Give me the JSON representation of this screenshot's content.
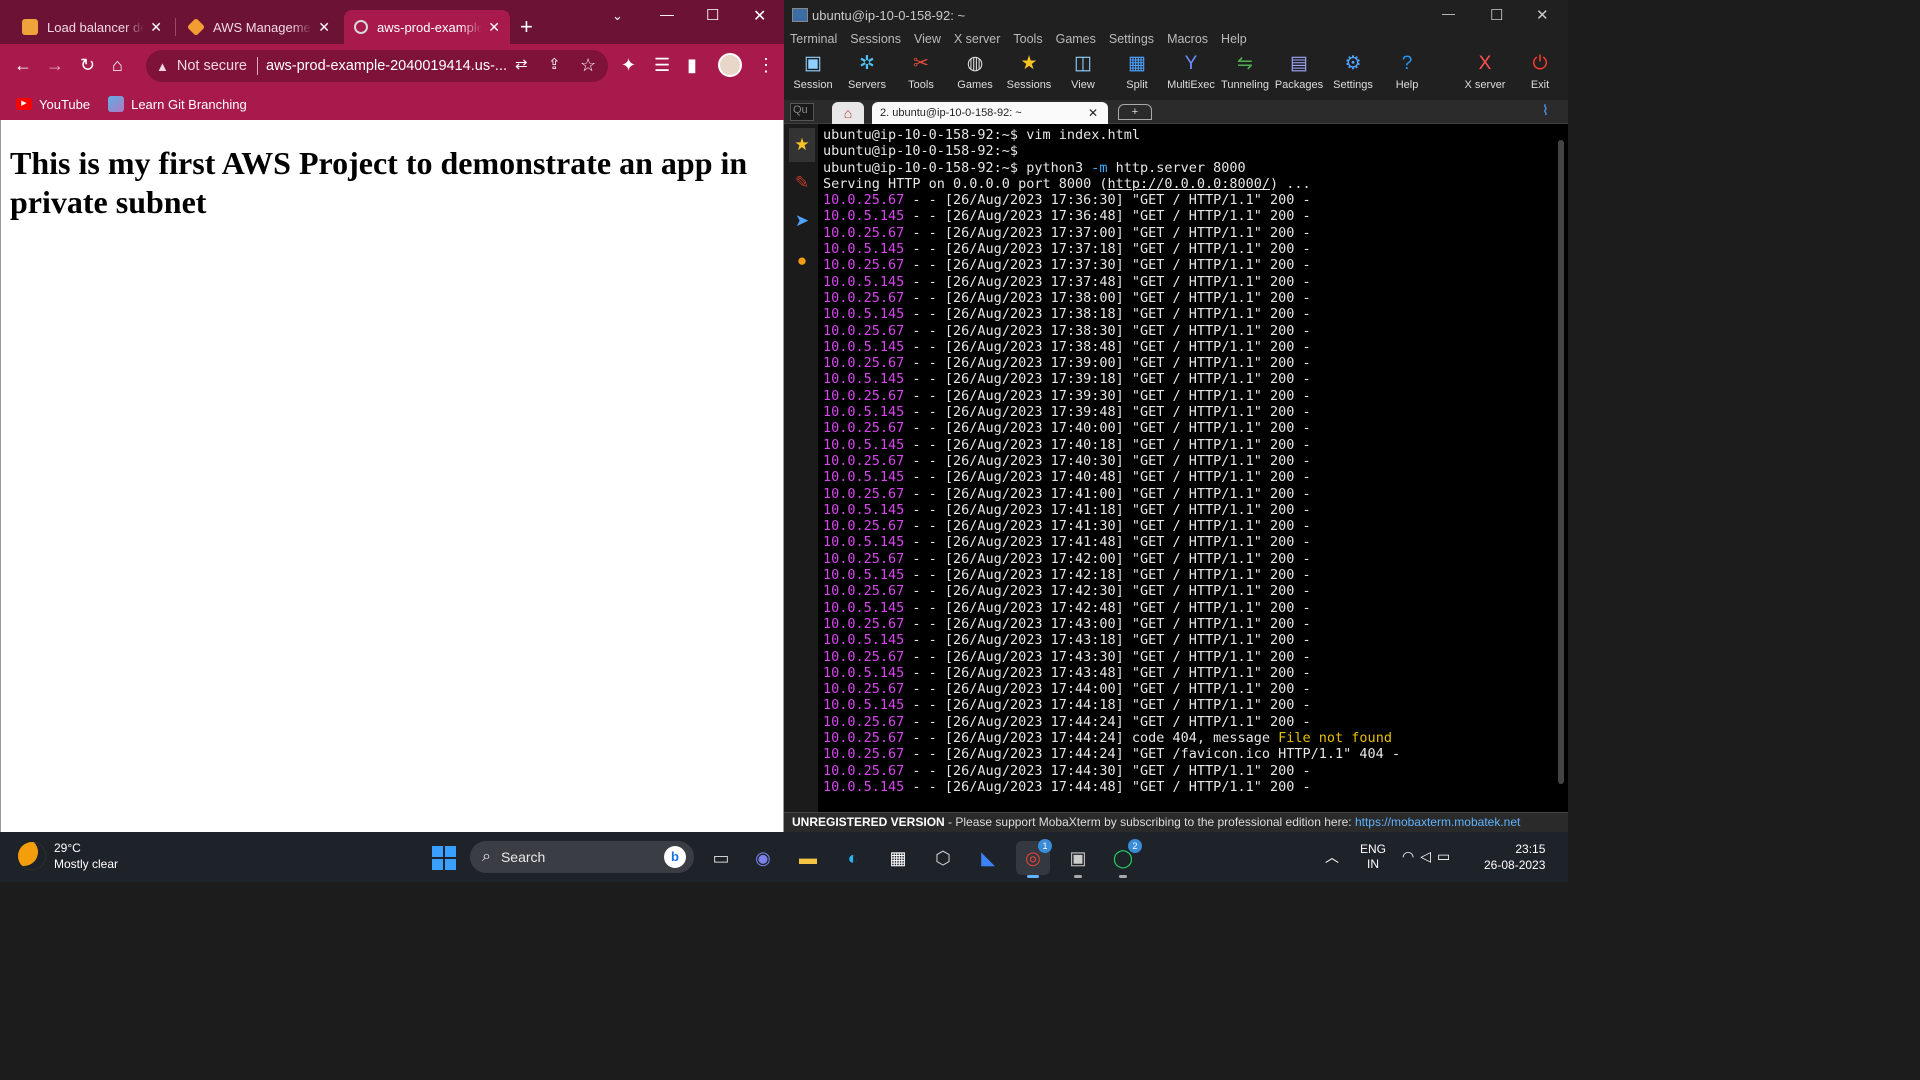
{
  "chrome": {
    "tabs": [
      {
        "title": "Load balancer deta",
        "favicon_color": "#f0a33a"
      },
      {
        "title": "AWS Management",
        "favicon_color": "#f39c32"
      },
      {
        "title": "aws-prod-example",
        "favicon_color": "#d7d7d7"
      }
    ],
    "address": {
      "security_label": "Not secure",
      "url": "aws-prod-example-2040019414.us-..."
    },
    "bookmarks": [
      {
        "label": "YouTube",
        "icon": "youtube-icon"
      },
      {
        "label": "Learn Git Branching",
        "icon": "git-icon"
      }
    ],
    "page_heading": "This is my first AWS Project to demonstrate an app in private subnet"
  },
  "moba": {
    "window_title": "ubuntu@ip-10-0-158-92: ~",
    "menu": [
      "Terminal",
      "Sessions",
      "View",
      "X server",
      "Tools",
      "Games",
      "Settings",
      "Macros",
      "Help"
    ],
    "toolbar": [
      {
        "label": "Session",
        "icon": "monitor-icon",
        "color": "#8fd0ff"
      },
      {
        "label": "Servers",
        "icon": "servers-icon",
        "color": "#4fc3f7"
      },
      {
        "label": "Tools",
        "icon": "tools-icon",
        "color": "#e74c3c"
      },
      {
        "label": "Games",
        "icon": "gamepad-icon",
        "color": "#dddddd"
      },
      {
        "label": "Sessions",
        "icon": "star-icon",
        "color": "#f7c325"
      },
      {
        "label": "View",
        "icon": "view-icon",
        "color": "#8fd0ff"
      },
      {
        "label": "Split",
        "icon": "split-icon",
        "color": "#4fa3ff"
      },
      {
        "label": "MultiExec",
        "icon": "multiexec-icon",
        "color": "#6c8cff"
      },
      {
        "label": "Tunneling",
        "icon": "tunneling-icon",
        "color": "#4caf50"
      },
      {
        "label": "Packages",
        "icon": "packages-icon",
        "color": "#9fa8ff"
      },
      {
        "label": "Settings",
        "icon": "settings-icon",
        "color": "#4fa3ff"
      },
      {
        "label": "Help",
        "icon": "help-icon",
        "color": "#2196f3"
      },
      {
        "label": "X server",
        "icon": "xserver-icon",
        "color": "#ff5252"
      },
      {
        "label": "Exit",
        "icon": "power-icon",
        "color": "#ff3b30"
      }
    ],
    "quick_connect": "Qu",
    "session_tab": "2. ubuntu@ip-10-0-158-92: ~",
    "terminal": {
      "prompt": "ubuntu@ip-10-0-158-92:~$",
      "commands": [
        {
          "cmd": "vim index.html"
        },
        {
          "cmd": ""
        },
        {
          "cmd_pre": "python3 ",
          "opt": "-m",
          "cmd_post": " http.server 8000"
        }
      ],
      "serving_pre": "Serving HTTP on 0.0.0.0 port 8000 (",
      "serving_link": "http://0.0.0.0:8000/",
      "serving_post": ") ...",
      "log": [
        {
          "ip": "10.0.25.67",
          "rest": " - - [26/Aug/2023 17:36:30] \"GET / HTTP/1.1\" 200 -"
        },
        {
          "ip": "10.0.5.145",
          "rest": " - - [26/Aug/2023 17:36:48] \"GET / HTTP/1.1\" 200 -"
        },
        {
          "ip": "10.0.25.67",
          "rest": " - - [26/Aug/2023 17:37:00] \"GET / HTTP/1.1\" 200 -"
        },
        {
          "ip": "10.0.5.145",
          "rest": " - - [26/Aug/2023 17:37:18] \"GET / HTTP/1.1\" 200 -"
        },
        {
          "ip": "10.0.25.67",
          "rest": " - - [26/Aug/2023 17:37:30] \"GET / HTTP/1.1\" 200 -"
        },
        {
          "ip": "10.0.5.145",
          "rest": " - - [26/Aug/2023 17:37:48] \"GET / HTTP/1.1\" 200 -"
        },
        {
          "ip": "10.0.25.67",
          "rest": " - - [26/Aug/2023 17:38:00] \"GET / HTTP/1.1\" 200 -"
        },
        {
          "ip": "10.0.5.145",
          "rest": " - - [26/Aug/2023 17:38:18] \"GET / HTTP/1.1\" 200 -"
        },
        {
          "ip": "10.0.25.67",
          "rest": " - - [26/Aug/2023 17:38:30] \"GET / HTTP/1.1\" 200 -"
        },
        {
          "ip": "10.0.5.145",
          "rest": " - - [26/Aug/2023 17:38:48] \"GET / HTTP/1.1\" 200 -"
        },
        {
          "ip": "10.0.25.67",
          "rest": " - - [26/Aug/2023 17:39:00] \"GET / HTTP/1.1\" 200 -"
        },
        {
          "ip": "10.0.5.145",
          "rest": " - - [26/Aug/2023 17:39:18] \"GET / HTTP/1.1\" 200 -"
        },
        {
          "ip": "10.0.25.67",
          "rest": " - - [26/Aug/2023 17:39:30] \"GET / HTTP/1.1\" 200 -"
        },
        {
          "ip": "10.0.5.145",
          "rest": " - - [26/Aug/2023 17:39:48] \"GET / HTTP/1.1\" 200 -"
        },
        {
          "ip": "10.0.25.67",
          "rest": " - - [26/Aug/2023 17:40:00] \"GET / HTTP/1.1\" 200 -"
        },
        {
          "ip": "10.0.5.145",
          "rest": " - - [26/Aug/2023 17:40:18] \"GET / HTTP/1.1\" 200 -"
        },
        {
          "ip": "10.0.25.67",
          "rest": " - - [26/Aug/2023 17:40:30] \"GET / HTTP/1.1\" 200 -"
        },
        {
          "ip": "10.0.5.145",
          "rest": " - - [26/Aug/2023 17:40:48] \"GET / HTTP/1.1\" 200 -"
        },
        {
          "ip": "10.0.25.67",
          "rest": " - - [26/Aug/2023 17:41:00] \"GET / HTTP/1.1\" 200 -"
        },
        {
          "ip": "10.0.5.145",
          "rest": " - - [26/Aug/2023 17:41:18] \"GET / HTTP/1.1\" 200 -"
        },
        {
          "ip": "10.0.25.67",
          "rest": " - - [26/Aug/2023 17:41:30] \"GET / HTTP/1.1\" 200 -"
        },
        {
          "ip": "10.0.5.145",
          "rest": " - - [26/Aug/2023 17:41:48] \"GET / HTTP/1.1\" 200 -"
        },
        {
          "ip": "10.0.25.67",
          "rest": " - - [26/Aug/2023 17:42:00] \"GET / HTTP/1.1\" 200 -"
        },
        {
          "ip": "10.0.5.145",
          "rest": " - - [26/Aug/2023 17:42:18] \"GET / HTTP/1.1\" 200 -"
        },
        {
          "ip": "10.0.25.67",
          "rest": " - - [26/Aug/2023 17:42:30] \"GET / HTTP/1.1\" 200 -"
        },
        {
          "ip": "10.0.5.145",
          "rest": " - - [26/Aug/2023 17:42:48] \"GET / HTTP/1.1\" 200 -"
        },
        {
          "ip": "10.0.25.67",
          "rest": " - - [26/Aug/2023 17:43:00] \"GET / HTTP/1.1\" 200 -"
        },
        {
          "ip": "10.0.5.145",
          "rest": " - - [26/Aug/2023 17:43:18] \"GET / HTTP/1.1\" 200 -"
        },
        {
          "ip": "10.0.25.67",
          "rest": " - - [26/Aug/2023 17:43:30] \"GET / HTTP/1.1\" 200 -"
        },
        {
          "ip": "10.0.5.145",
          "rest": " - - [26/Aug/2023 17:43:48] \"GET / HTTP/1.1\" 200 -"
        },
        {
          "ip": "10.0.25.67",
          "rest": " - - [26/Aug/2023 17:44:00] \"GET / HTTP/1.1\" 200 -"
        },
        {
          "ip": "10.0.5.145",
          "rest": " - - [26/Aug/2023 17:44:18] \"GET / HTTP/1.1\" 200 -"
        },
        {
          "ip": "10.0.25.67",
          "rest": " - - [26/Aug/2023 17:44:24] \"GET / HTTP/1.1\" 200 -"
        },
        {
          "ip": "10.0.25.67",
          "rest": " - - [26/Aug/2023 17:44:24] code 404, message ",
          "highlight": "File not found"
        },
        {
          "ip": "10.0.25.67",
          "rest": " - - [26/Aug/2023 17:44:24] \"GET /favicon.ico HTTP/1.1\" 404 -"
        },
        {
          "ip": "10.0.25.67",
          "rest": " - - [26/Aug/2023 17:44:30] \"GET / HTTP/1.1\" 200 -"
        },
        {
          "ip": "10.0.5.145",
          "rest": " - - [26/Aug/2023 17:44:48] \"GET / HTTP/1.1\" 200 -"
        }
      ]
    },
    "status": {
      "unregistered": "UNREGISTERED VERSION",
      "message": " -  Please support MobaXterm by subscribing to the professional edition here: ",
      "link": "https://mobaxterm.mobatek.net"
    }
  },
  "taskbar": {
    "weather": {
      "temp": "29°C",
      "condition": "Mostly clear"
    },
    "search_placeholder": "Search",
    "apps": [
      {
        "name": "task-view-icon",
        "color": "#d0d0d0",
        "glyph": "▭"
      },
      {
        "name": "teams-icon",
        "color": "#7b83eb",
        "glyph": "◉"
      },
      {
        "name": "file-explorer-icon",
        "color": "#f6c445",
        "glyph": "▬"
      },
      {
        "name": "edge-icon",
        "color": "#29b6f6",
        "glyph": "◐"
      },
      {
        "name": "store-icon",
        "color": "#ffffff",
        "glyph": "▦"
      },
      {
        "name": "unity-icon",
        "color": "#cfcfcf",
        "glyph": "⬡"
      },
      {
        "name": "vscode-icon",
        "color": "#3b82f6",
        "glyph": "◣"
      },
      {
        "name": "chrome-icon",
        "color": "#ea4335",
        "glyph": "◎",
        "badge": "1"
      },
      {
        "name": "mobaxterm-icon",
        "color": "#cccccc",
        "glyph": "▣"
      },
      {
        "name": "whatsapp-icon",
        "color": "#25d366",
        "glyph": "◯",
        "badge": "2"
      }
    ],
    "language": {
      "line1": "ENG",
      "line2": "IN"
    },
    "time": "23:15",
    "date": "26-08-2023"
  }
}
